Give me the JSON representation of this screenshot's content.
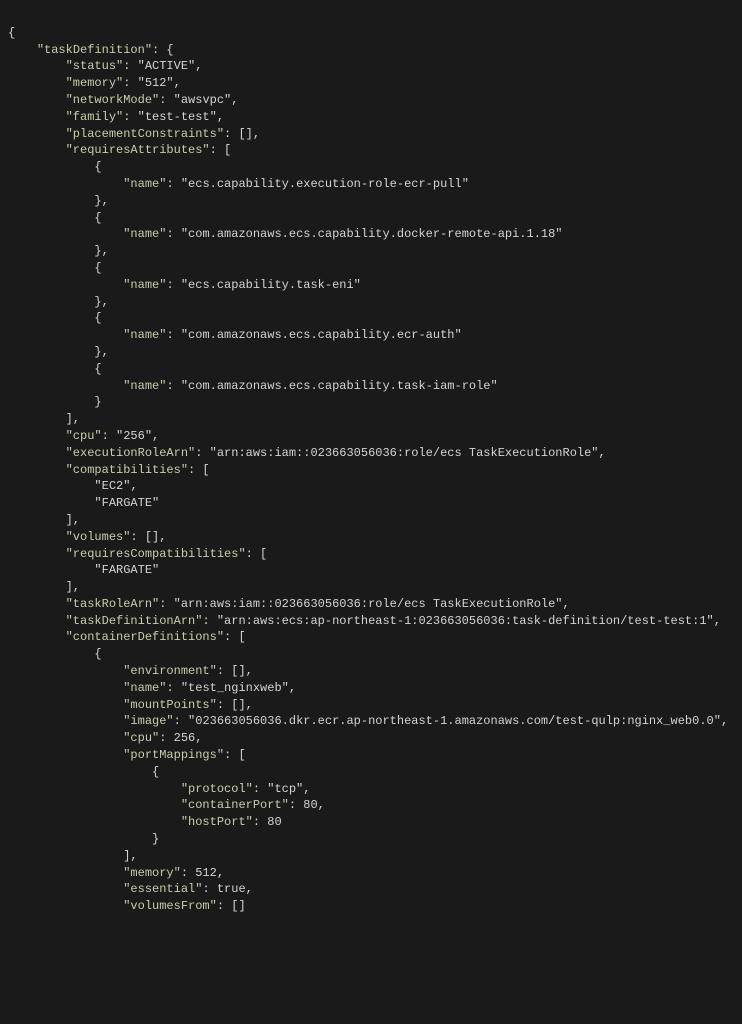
{
  "taskDefinition": {
    "k": "\"taskDefinition\""
  },
  "status": {
    "k": "\"status\"",
    "v": "\"ACTIVE\""
  },
  "memory": {
    "k": "\"memory\"",
    "v": "\"512\""
  },
  "networkMode": {
    "k": "\"networkMode\"",
    "v": "\"awsvpc\""
  },
  "family": {
    "k": "\"family\"",
    "v": "\"test-test\""
  },
  "placementConstraints": {
    "k": "\"placementConstraints\""
  },
  "requiresAttributes": {
    "k": "\"requiresAttributes\""
  },
  "nameKey": "\"name\"",
  "reqAttrs": [
    "\"ecs.capability.execution-role-ecr-pull\"",
    "\"com.amazonaws.ecs.capability.docker-remote-api.1.18\"",
    "\"ecs.capability.task-eni\"",
    "\"com.amazonaws.ecs.capability.ecr-auth\"",
    "\"com.amazonaws.ecs.capability.task-iam-role\""
  ],
  "cpu": {
    "k": "\"cpu\"",
    "v": "\"256\""
  },
  "executionRoleArn": {
    "k": "\"executionRoleArn\"",
    "v": "\"arn:aws:iam::023663056036:role/ecs TaskExecutionRole\""
  },
  "compatibilities": {
    "k": "\"compatibilities\""
  },
  "compat": [
    "\"EC2\"",
    "\"FARGATE\""
  ],
  "volumes": {
    "k": "\"volumes\""
  },
  "requiresCompatibilities": {
    "k": "\"requiresCompatibilities\""
  },
  "reqCompat": [
    "\"FARGATE\""
  ],
  "taskRoleArn": {
    "k": "\"taskRoleArn\"",
    "v": "\"arn:aws:iam::023663056036:role/ecs TaskExecutionRole\""
  },
  "taskDefinitionArn": {
    "k": "\"taskDefinitionArn\"",
    "v": "\"arn:aws:ecs:ap-northeast-1:023663056036:task-definition/test-test:1\""
  },
  "containerDefinitions": {
    "k": "\"containerDefinitions\""
  },
  "cd": {
    "environment": {
      "k": "\"environment\""
    },
    "name": {
      "k": "\"name\"",
      "v": "\"test_nginxweb\""
    },
    "mountPoints": {
      "k": "\"mountPoints\""
    },
    "image": {
      "k": "\"image\"",
      "v": "\"023663056036.dkr.ecr.ap-northeast-1.amazonaws.com/test-qulp:nginx_web0.0\""
    },
    "cpu": {
      "k": "\"cpu\"",
      "v": "256"
    },
    "portMappings": {
      "k": "\"portMappings\""
    },
    "memory": {
      "k": "\"memory\"",
      "v": "512"
    },
    "essential": {
      "k": "\"essential\"",
      "v": "true"
    },
    "volumesFrom": {
      "k": "\"volumesFrom\""
    }
  },
  "pm": {
    "protocol": {
      "k": "\"protocol\"",
      "v": "\"tcp\""
    },
    "containerPort": {
      "k": "\"containerPort\"",
      "v": "80"
    },
    "hostPort": {
      "k": "\"hostPort\"",
      "v": "80"
    }
  }
}
